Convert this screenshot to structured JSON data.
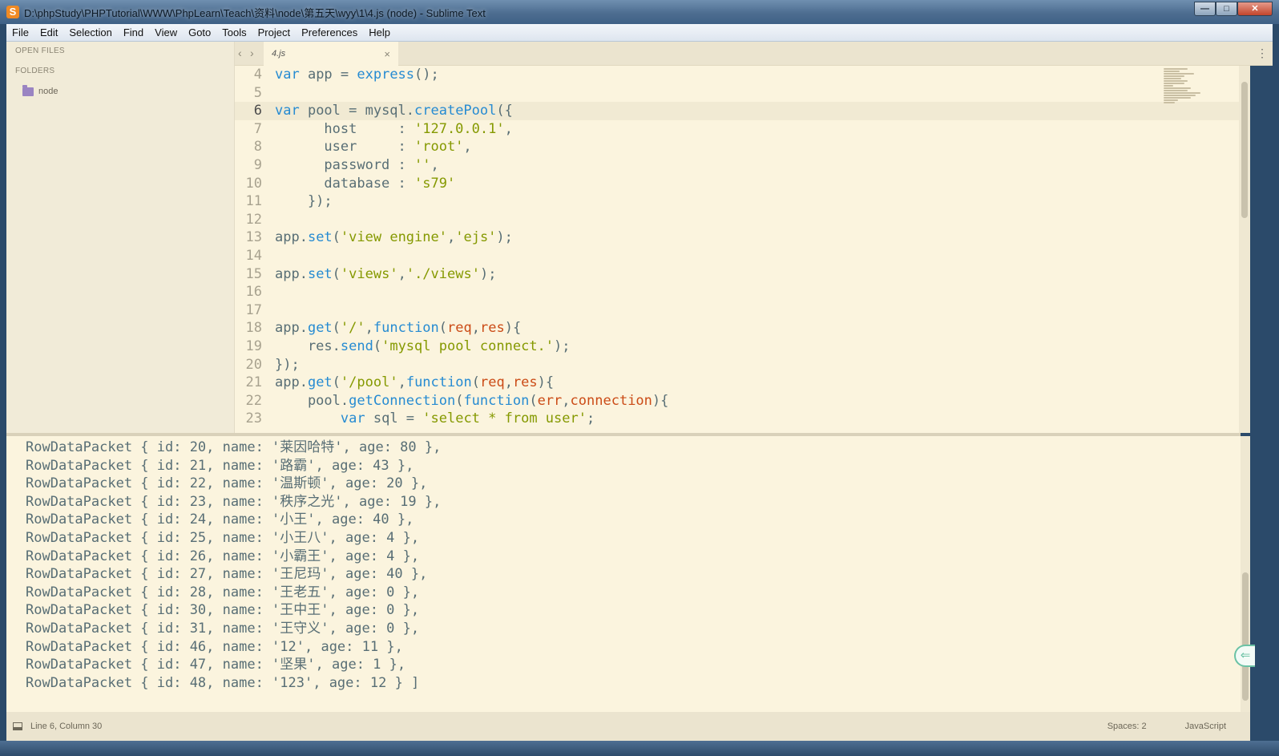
{
  "window": {
    "title": "D:\\phpStudy\\PHPTutorial\\WWW\\PhpLearn\\Teach\\资料\\node\\第五天\\wyy\\1\\4.js (node) - Sublime Text",
    "app_icon": "S",
    "minimize": "—",
    "maximize": "□",
    "close": "✕"
  },
  "menu": [
    "File",
    "Edit",
    "Selection",
    "Find",
    "View",
    "Goto",
    "Tools",
    "Project",
    "Preferences",
    "Help"
  ],
  "sidebar": {
    "open_files_heading": "OPEN FILES",
    "folders_heading": "FOLDERS",
    "folder_name": "node"
  },
  "tabs": {
    "back": "‹",
    "forward": "›",
    "active_tab": "4.js",
    "close": "×",
    "menu": "⋮"
  },
  "editor": {
    "current_line": 6,
    "lines": [
      {
        "n": "4",
        "tokens": [
          [
            "kw",
            "var"
          ],
          [
            "",
            "app = "
          ],
          [
            "fn",
            "express"
          ],
          [
            "",
            "();"
          ]
        ]
      },
      {
        "n": "5",
        "tokens": []
      },
      {
        "n": "6",
        "tokens": [
          [
            "kw",
            "var"
          ],
          [
            "",
            "pool = mysql."
          ],
          [
            "fn",
            "createPool"
          ],
          [
            "",
            "({"
          ]
        ]
      },
      {
        "n": "7",
        "tokens": [
          [
            "",
            "      host     : "
          ],
          [
            "str",
            "'127.0.0.1'"
          ],
          [
            "",
            ","
          ]
        ]
      },
      {
        "n": "8",
        "tokens": [
          [
            "",
            "      user     : "
          ],
          [
            "str",
            "'root'"
          ],
          [
            "",
            ","
          ]
        ]
      },
      {
        "n": "9",
        "tokens": [
          [
            "",
            "      password : "
          ],
          [
            "str",
            "''"
          ],
          [
            "",
            ","
          ]
        ]
      },
      {
        "n": "10",
        "tokens": [
          [
            "",
            "      database : "
          ],
          [
            "str",
            "'s79'"
          ]
        ]
      },
      {
        "n": "11",
        "tokens": [
          [
            "",
            "    });"
          ]
        ]
      },
      {
        "n": "12",
        "tokens": []
      },
      {
        "n": "13",
        "tokens": [
          [
            "",
            "app."
          ],
          [
            "fn",
            "set"
          ],
          [
            "",
            "("
          ],
          [
            "str",
            "'view engine'"
          ],
          [
            "",
            ","
          ],
          [
            "str",
            "'ejs'"
          ],
          [
            "",
            ");"
          ]
        ]
      },
      {
        "n": "14",
        "tokens": []
      },
      {
        "n": "15",
        "tokens": [
          [
            "",
            "app."
          ],
          [
            "fn",
            "set"
          ],
          [
            "",
            "("
          ],
          [
            "str",
            "'views'"
          ],
          [
            "",
            ","
          ],
          [
            "str",
            "'./views'"
          ],
          [
            "",
            ");"
          ]
        ]
      },
      {
        "n": "16",
        "tokens": []
      },
      {
        "n": "17",
        "tokens": []
      },
      {
        "n": "18",
        "tokens": [
          [
            "",
            "app."
          ],
          [
            "fn",
            "get"
          ],
          [
            "",
            "("
          ],
          [
            "str",
            "'/'"
          ],
          [
            "",
            ","
          ],
          [
            "kw",
            "function"
          ],
          [
            "",
            "("
          ],
          [
            "prm",
            "req"
          ],
          [
            "",
            ","
          ],
          [
            "prm",
            "res"
          ],
          [
            "",
            "){"
          ]
        ]
      },
      {
        "n": "19",
        "tokens": [
          [
            "",
            "    res."
          ],
          [
            "fn",
            "send"
          ],
          [
            "",
            "("
          ],
          [
            "str",
            "'mysql pool connect.'"
          ],
          [
            "",
            ");"
          ]
        ]
      },
      {
        "n": "20",
        "tokens": [
          [
            "",
            "});"
          ]
        ]
      },
      {
        "n": "21",
        "tokens": [
          [
            "",
            "app."
          ],
          [
            "fn",
            "get"
          ],
          [
            "",
            "("
          ],
          [
            "str",
            "'/pool'"
          ],
          [
            "",
            ","
          ],
          [
            "kw",
            "function"
          ],
          [
            "",
            "("
          ],
          [
            "prm",
            "req"
          ],
          [
            "",
            ","
          ],
          [
            "prm",
            "res"
          ],
          [
            "",
            "){"
          ]
        ]
      },
      {
        "n": "22",
        "tokens": [
          [
            "",
            "    pool."
          ],
          [
            "fn",
            "getConnection"
          ],
          [
            "",
            "("
          ],
          [
            "kw",
            "function"
          ],
          [
            "",
            "("
          ],
          [
            "prm",
            "err"
          ],
          [
            "",
            ","
          ],
          [
            "prm",
            "connection"
          ],
          [
            "",
            "){"
          ]
        ]
      },
      {
        "n": "23",
        "tokens": [
          [
            "",
            "        "
          ],
          [
            "kw",
            "var"
          ],
          [
            "",
            "sql = "
          ],
          [
            "str",
            "'select * from user'"
          ],
          [
            "",
            ";"
          ]
        ]
      }
    ]
  },
  "output": {
    "lines": [
      "RowDataPacket { id: 20, name: '莱因哈特', age: 80 },",
      "RowDataPacket { id: 21, name: '路霸', age: 43 },",
      "RowDataPacket { id: 22, name: '温斯顿', age: 20 },",
      "RowDataPacket { id: 23, name: '秩序之光', age: 19 },",
      "RowDataPacket { id: 24, name: '小王', age: 40 },",
      "RowDataPacket { id: 25, name: '小王八', age: 4 },",
      "RowDataPacket { id: 26, name: '小霸王', age: 4 },",
      "RowDataPacket { id: 27, name: '王尼玛', age: 40 },",
      "RowDataPacket { id: 28, name: '王老五', age: 0 },",
      "RowDataPacket { id: 30, name: '王中王', age: 0 },",
      "RowDataPacket { id: 31, name: '王守义', age: 0 },",
      "RowDataPacket { id: 46, name: '12', age: 11 },",
      "RowDataPacket { id: 47, name: '坚果', age: 1 },",
      "RowDataPacket { id: 48, name: '123', age: 12 } ]"
    ]
  },
  "status": {
    "position": "Line 6, Column 30",
    "spaces": "Spaces: 2",
    "syntax": "JavaScript"
  },
  "colors": {
    "background": "#fbf4de",
    "keyword": "#268bd2",
    "string": "#859900",
    "param": "#cb4b16",
    "text": "#586e75"
  }
}
